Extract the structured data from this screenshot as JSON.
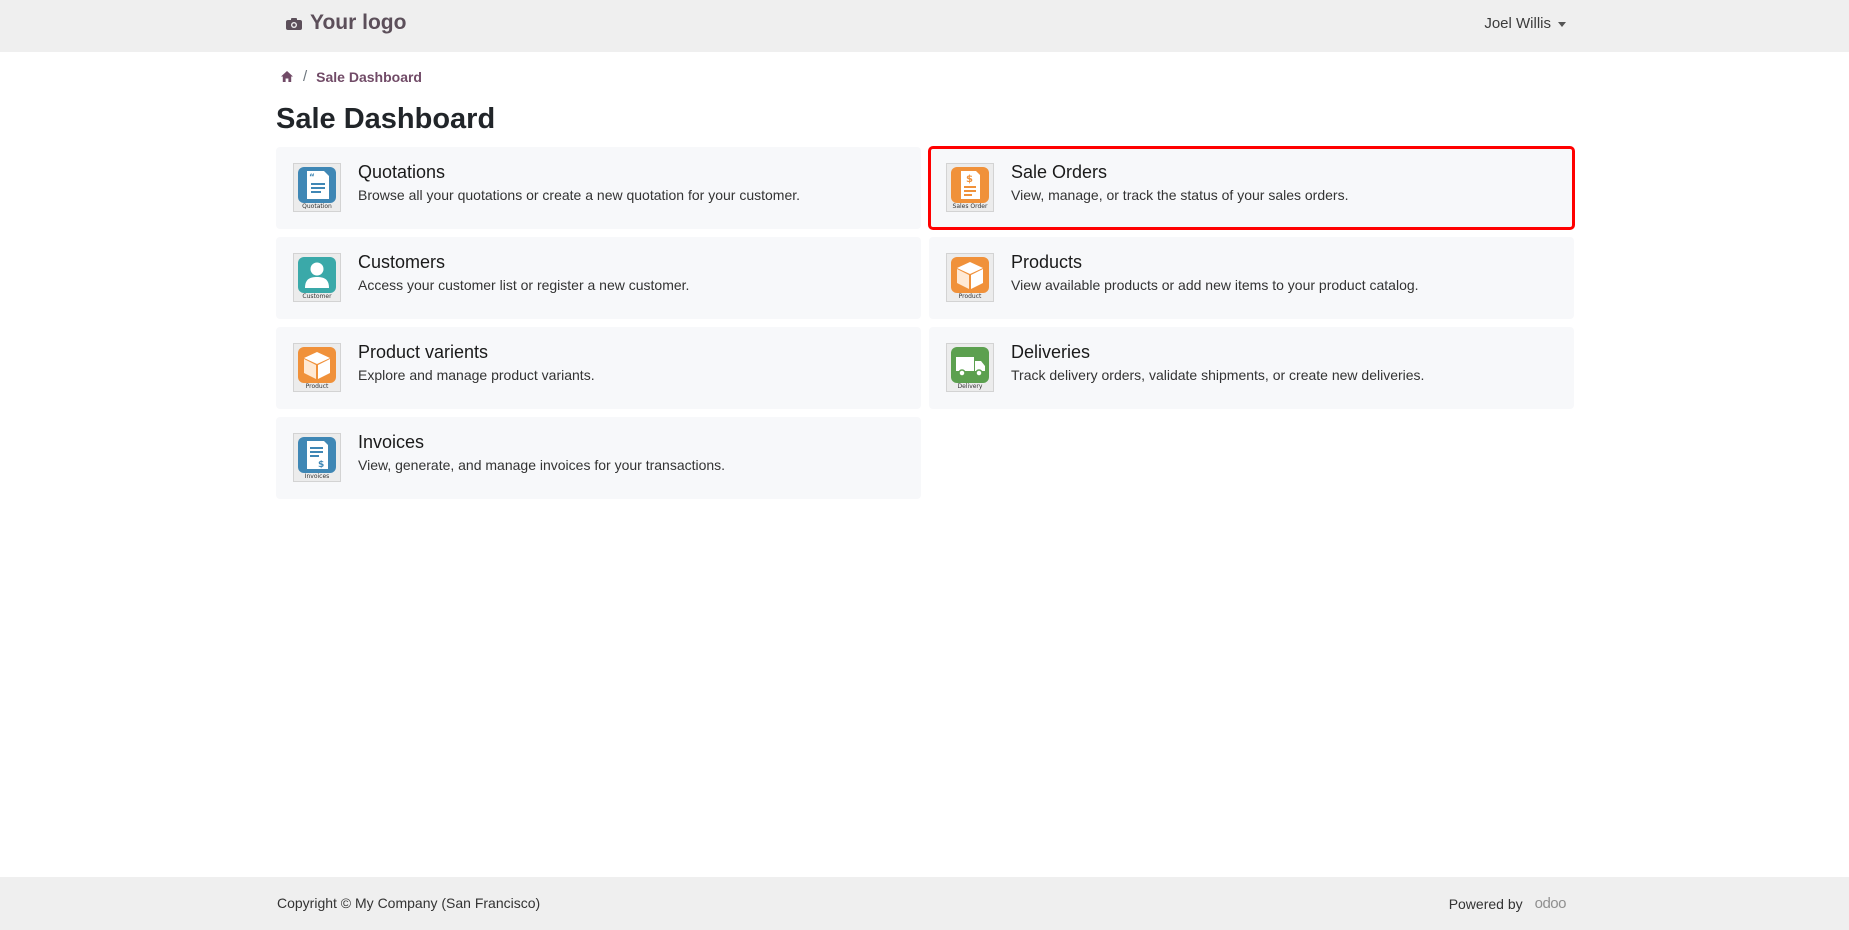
{
  "header": {
    "logo_text": "Your logo",
    "user_name": "Joel Willis"
  },
  "breadcrumb": {
    "current": "Sale Dashboard"
  },
  "page": {
    "title": "Sale Dashboard"
  },
  "cards": [
    {
      "title": "Quotations",
      "description": "Browse all your quotations or create a new quotation for your customer.",
      "icon": "quotation-icon",
      "icon_caption": "Quotation",
      "color": "#3f87b5"
    },
    {
      "title": "Sale Orders",
      "description": "View, manage, or track the status of your sales orders.",
      "icon": "sales-order-icon",
      "icon_caption": "Sales Order",
      "color": "#f0913a"
    },
    {
      "title": "Customers",
      "description": "Access your customer list or register a new customer.",
      "icon": "customer-icon",
      "icon_caption": "Customer",
      "color": "#3aa9a9"
    },
    {
      "title": "Products",
      "description": "View available products or add new items to your product catalog.",
      "icon": "product-icon",
      "icon_caption": "Product",
      "color": "#f0913a"
    },
    {
      "title": "Product varients",
      "description": "Explore and manage product variants.",
      "icon": "product-icon",
      "icon_caption": "Product",
      "color": "#f0913a"
    },
    {
      "title": "Deliveries",
      "description": "Track delivery orders, validate shipments, or create new deliveries.",
      "icon": "delivery-icon",
      "icon_caption": "Delivery",
      "color": "#5ca04f"
    },
    {
      "title": "Invoices",
      "description": "View, generate, and manage invoices for your transactions.",
      "icon": "invoice-icon",
      "icon_caption": "Invoices",
      "color": "#3f87b5"
    }
  ],
  "footer": {
    "copyright": "Copyright © My Company (San Francisco)",
    "powered_by": "Powered by",
    "brand": "odoo"
  },
  "colors": {
    "brand": "#714b67",
    "highlight": "#ff0000"
  }
}
